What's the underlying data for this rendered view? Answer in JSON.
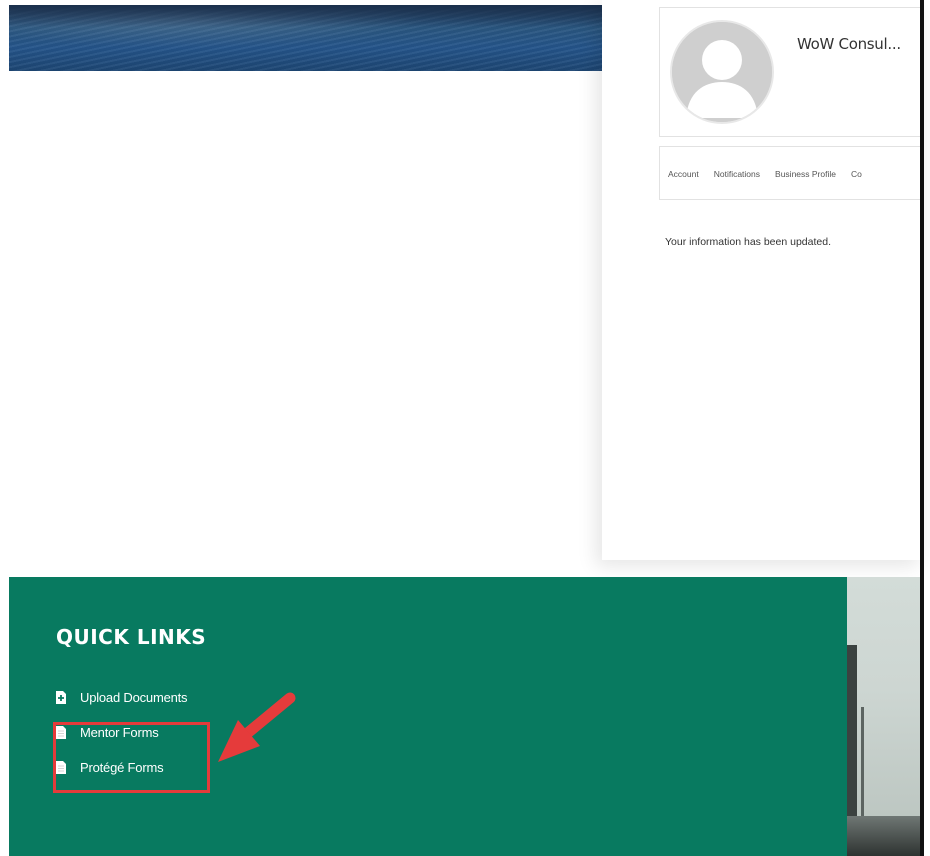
{
  "profile": {
    "company_name": "WoW Consul...",
    "avatar_icon": "default-user-avatar-icon"
  },
  "tabs": [
    {
      "label": "Account"
    },
    {
      "label": "Notifications"
    },
    {
      "label": "Business Profile"
    },
    {
      "label": "Co"
    }
  ],
  "status_message": "Your information has been updated.",
  "footer": {
    "title": "QUICK LINKS",
    "links": [
      {
        "label": "Upload Documents",
        "icon": "file-upload-icon"
      },
      {
        "label": "Mentor Forms",
        "icon": "document-icon"
      },
      {
        "label": "Protégé Forms",
        "icon": "document-icon"
      }
    ]
  },
  "colors": {
    "footer_bg": "#087a60",
    "annotation": "#e53b3b"
  }
}
